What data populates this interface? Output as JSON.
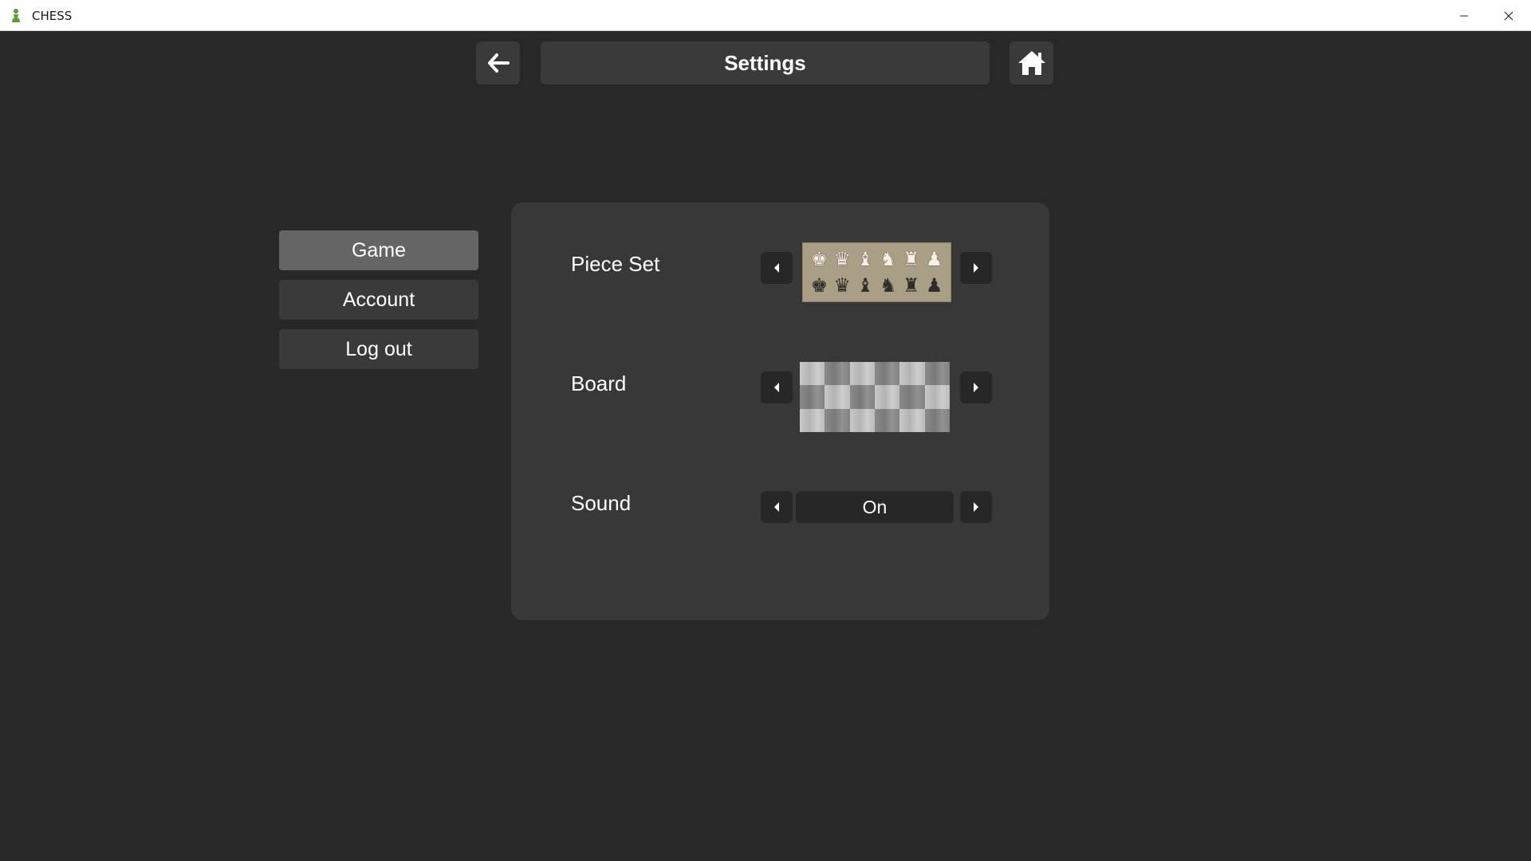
{
  "window": {
    "title": "CHESS",
    "minimize_icon": "minimize-icon",
    "close_icon": "close-icon"
  },
  "header": {
    "title": "Settings",
    "back_icon": "arrow-left-icon",
    "home_icon": "home-icon"
  },
  "sidebar": {
    "items": [
      {
        "label": "Game",
        "active": true
      },
      {
        "label": "Account",
        "active": false
      },
      {
        "label": "Log out",
        "active": false
      }
    ]
  },
  "settings": {
    "piece_set": {
      "label": "Piece Set",
      "white_pieces": [
        "♚",
        "♛",
        "♝",
        "♞",
        "♜",
        "♟"
      ],
      "black_pieces": [
        "♚",
        "♛",
        "♝",
        "♞",
        "♜",
        "♟"
      ]
    },
    "board": {
      "label": "Board"
    },
    "sound": {
      "label": "Sound",
      "value": "On"
    }
  },
  "colors": {
    "background": "#282828",
    "panel": "#383838",
    "button": "#3a3a3a",
    "active_button": "#656565",
    "arrow_button": "#272727",
    "app_icon": "#5aa02c"
  }
}
